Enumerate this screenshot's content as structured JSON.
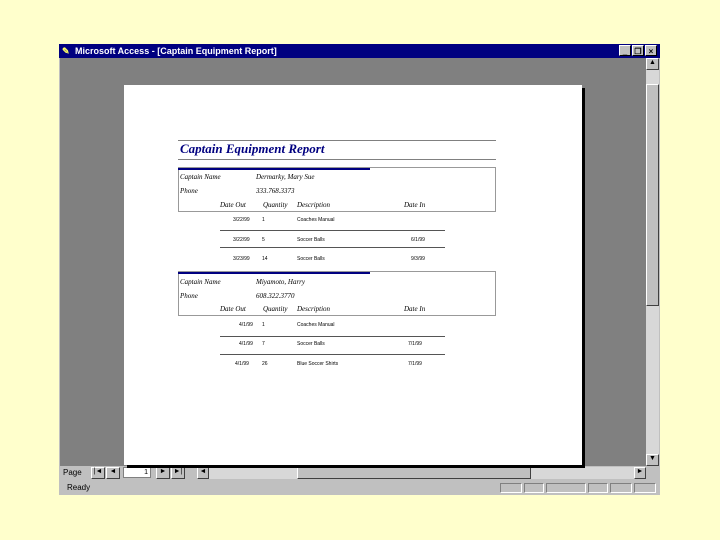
{
  "window": {
    "title": "Microsoft Access - [Captain Equipment Report]",
    "app_icon": "key-icon",
    "controls": {
      "minimize": "_",
      "restore": "❐",
      "close": "×"
    }
  },
  "report": {
    "title": "Captain Equipment Report",
    "captain_label": "Captain Name",
    "phone_label": "Phone",
    "columns": [
      "Date Out",
      "Quantity",
      "Description",
      "Date In"
    ],
    "groups": [
      {
        "captain": "Dermarky, Mary Sue",
        "phone": "333.768.3373",
        "rows": [
          {
            "date_out": "3/22/99",
            "quantity": "1",
            "description": "Coaches Manual",
            "date_in": ""
          },
          {
            "date_out": "3/22/99",
            "quantity": "5",
            "description": "Soccer Balls",
            "date_in": "6/1/99"
          },
          {
            "date_out": "3/23/99",
            "quantity": "14",
            "description": "Soccer Balls",
            "date_in": "9/3/99"
          }
        ]
      },
      {
        "captain": "Miyamoto, Harry",
        "phone": "608.322.3770",
        "rows": [
          {
            "date_out": "4/1/99",
            "quantity": "1",
            "description": "Coaches Manual",
            "date_in": ""
          },
          {
            "date_out": "4/1/99",
            "quantity": "7",
            "description": "Soccer Balls",
            "date_in": "7/1/99"
          },
          {
            "date_out": "4/1/99",
            "quantity": "26",
            "description": "Blue Soccer Shirts",
            "date_in": "7/1/99"
          }
        ]
      }
    ]
  },
  "navigation": {
    "page_label": "Page",
    "page_number": "1",
    "buttons": {
      "first": "|◄",
      "prev": "◄",
      "next": "►",
      "last": "►|"
    }
  },
  "status": {
    "text": "Ready"
  }
}
